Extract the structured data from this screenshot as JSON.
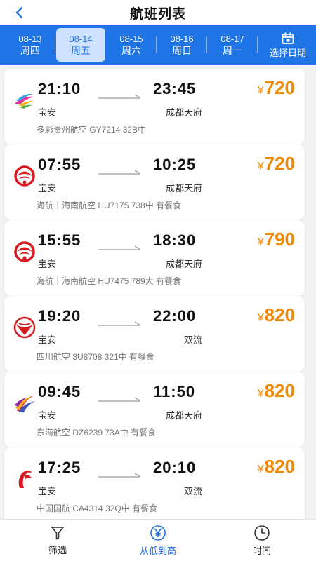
{
  "header": {
    "title": "航班列表"
  },
  "date_bar": {
    "tabs": [
      {
        "date": "08-13",
        "weekday": "周四",
        "active": false
      },
      {
        "date": "08-14",
        "weekday": "周五",
        "active": true
      },
      {
        "date": "08-15",
        "weekday": "周六",
        "active": false
      },
      {
        "date": "08-16",
        "weekday": "周日",
        "active": false
      },
      {
        "date": "08-17",
        "weekday": "周一",
        "active": false
      }
    ],
    "pick_date_label": "选择日期"
  },
  "flights": [
    {
      "airline_icon": "colorful-guizhou-logo",
      "dep_time": "21:10",
      "dep_airport": "宝安",
      "arr_time": "23:45",
      "arr_airport": "成都天府",
      "currency": "¥",
      "price": "720",
      "info": "多彩贵州航空 GY7214 32B中"
    },
    {
      "airline_icon": "hainan-airlines-logo",
      "dep_time": "07:55",
      "dep_airport": "宝安",
      "arr_time": "10:25",
      "arr_airport": "成都天府",
      "currency": "¥",
      "price": "720",
      "info": "海航｜海南航空 HU7175 738中 有餐食"
    },
    {
      "airline_icon": "hainan-airlines-logo",
      "dep_time": "15:55",
      "dep_airport": "宝安",
      "arr_time": "18:30",
      "arr_airport": "成都天府",
      "currency": "¥",
      "price": "790",
      "info": "海航｜海南航空 HU7475 789大 有餐食"
    },
    {
      "airline_icon": "sichuan-airlines-logo",
      "dep_time": "19:20",
      "dep_airport": "宝安",
      "arr_time": "22:00",
      "arr_airport": "双流",
      "currency": "¥",
      "price": "820",
      "info": "四川航空 3U8708 321中 有餐食"
    },
    {
      "airline_icon": "donghai-airlines-logo",
      "dep_time": "09:45",
      "dep_airport": "宝安",
      "arr_time": "11:50",
      "arr_airport": "成都天府",
      "currency": "¥",
      "price": "820",
      "info": "东海航空 DZ6239 73A中 有餐食"
    },
    {
      "airline_icon": "air-china-logo",
      "dep_time": "17:25",
      "dep_airport": "宝安",
      "arr_time": "20:10",
      "arr_airport": "双流",
      "currency": "¥",
      "price": "820",
      "info": "中国国航 CA4314 32Q中 有餐食"
    }
  ],
  "tab_bar": {
    "filter": {
      "label": "筛选",
      "icon": "filter-icon"
    },
    "sort_price": {
      "label": "从低到高",
      "icon": "yuan-circle-icon",
      "active": true
    },
    "time": {
      "label": "时间",
      "icon": "clock-icon"
    }
  },
  "colors": {
    "primary": "#1f74e6",
    "price": "#f08800",
    "active_date_bg": "#cfe2ff"
  }
}
